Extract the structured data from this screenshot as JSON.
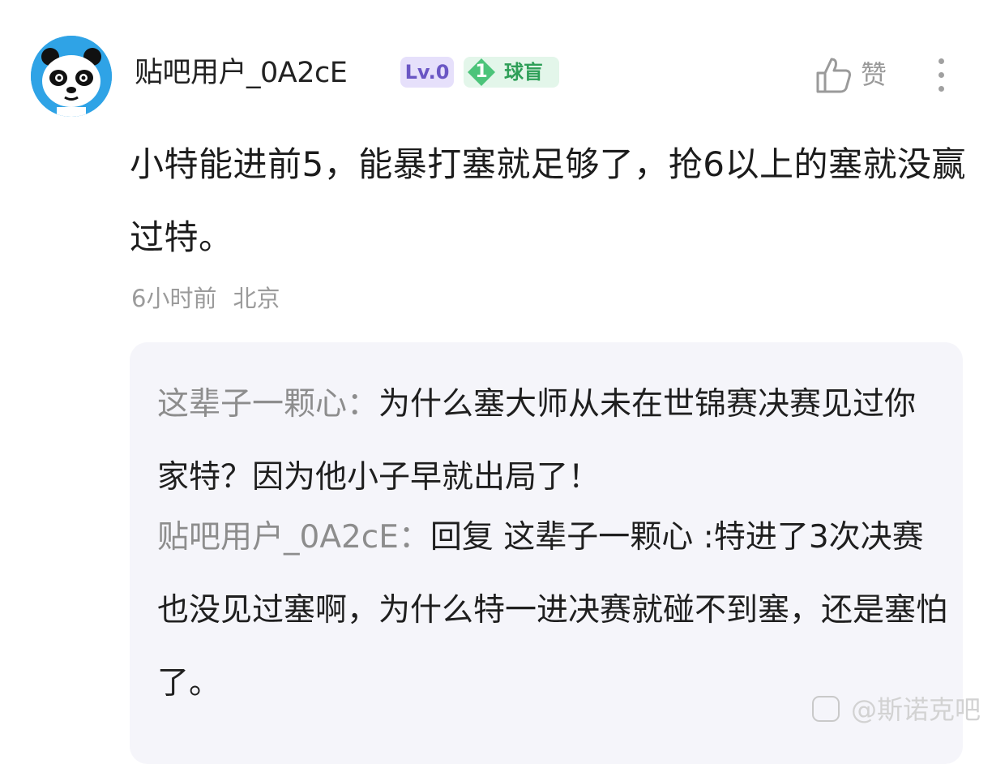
{
  "comment": {
    "username": "贴吧用户_0A2cE",
    "level_badge": "Lv.0",
    "fan_badge": {
      "level": "1",
      "label": "球盲"
    },
    "like_label": "赞",
    "text": "小特能进前5，能暴打塞就足够了，抢6以上的塞就没赢过特。",
    "time": "6小时前",
    "location": "北京"
  },
  "replies": [
    {
      "author": "这辈子一颗心：",
      "text": "为什么塞大师从未在世锦赛决赛见过你家特？因为他小子早就出局了！"
    },
    {
      "author": "贴吧用户_0A2cE：",
      "text": "回复 这辈子一颗心 :特进了3次决赛也没见过塞啊，为什么特一进决赛就碰不到塞，还是塞怕了。"
    }
  ],
  "watermark": {
    "text": "@斯诺克吧"
  },
  "colors": {
    "avatar_bg": "#2fa3e6",
    "level_badge_bg": "#e6e0fb",
    "level_badge_fg": "#6a56c4",
    "fan_badge_bg": "#e3f6ea",
    "fan_badge_fg": "#2e9f58",
    "reply_box_bg": "#f5f5fa"
  },
  "icons": {
    "avatar": "panda-avatar",
    "like": "thumbs-up-icon",
    "more": "more-vertical-icon",
    "fan_level": "diamond-icon"
  }
}
